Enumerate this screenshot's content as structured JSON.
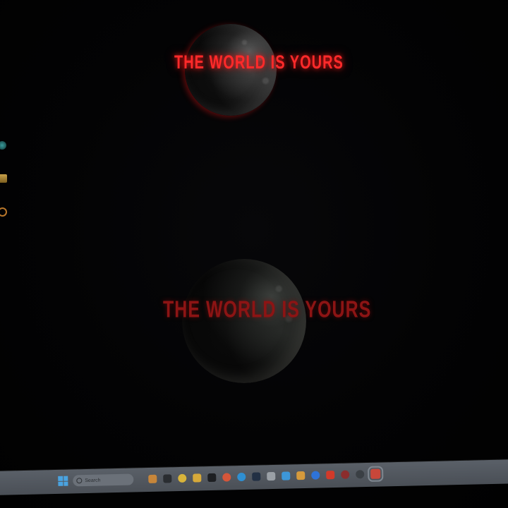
{
  "wallpaper": {
    "slogan_top": "THE WORLD IS YOURS",
    "slogan_bottom": "THE WORLD IS YOURS"
  },
  "desktop_icons": [
    {
      "icon": "app-icon-teal"
    },
    {
      "icon": "folder-icon"
    },
    {
      "icon": "browser-icon-orange"
    }
  ],
  "taskbar": {
    "search_placeholder": "Search",
    "colors": {
      "start": "#4aa3e0",
      "taskbar_bg": "#52575e"
    },
    "apps": [
      {
        "icon": "animal-app-icon",
        "color": "#c7863a"
      },
      {
        "icon": "task-view-icon",
        "color": "#2a2d31"
      },
      {
        "icon": "chrome-icon",
        "color": "#d8b43b"
      },
      {
        "icon": "file-explorer-icon",
        "color": "#d6a93a"
      },
      {
        "icon": "media-app-icon",
        "color": "#1d1f22"
      },
      {
        "icon": "brave-icon",
        "color": "#d5563a"
      },
      {
        "icon": "edge-icon",
        "color": "#2f8fd1"
      },
      {
        "icon": "store-icon",
        "color": "#223044"
      },
      {
        "icon": "controller-icon",
        "color": "#9aa0a6"
      },
      {
        "icon": "paint-icon",
        "color": "#3d97d8"
      },
      {
        "icon": "cat-app-icon",
        "color": "#d59a3c"
      },
      {
        "icon": "facebook-icon",
        "color": "#2e73d8"
      },
      {
        "icon": "youtube-icon",
        "color": "#d23a2a"
      },
      {
        "icon": "record-icon",
        "color": "#8b2d2d"
      },
      {
        "icon": "settings-icon",
        "color": "#3a3f44"
      },
      {
        "icon": "active-app-icon",
        "color": "#c9473a"
      }
    ]
  }
}
